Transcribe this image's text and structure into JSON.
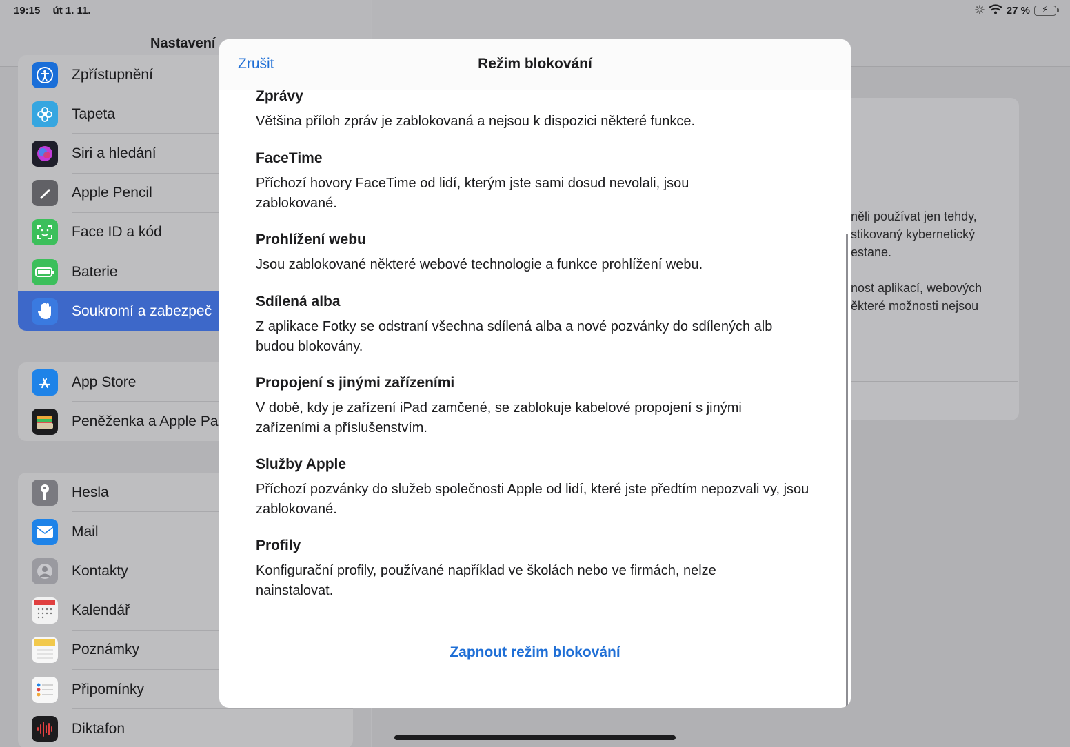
{
  "status": {
    "time": "19:15",
    "date": "út 1. 11.",
    "battery": "27 %",
    "battery_level": 0.27
  },
  "sidebar": {
    "title": "Nastavení",
    "group1": [
      {
        "label": "Zpřístupnění",
        "icon": "accessibility-icon",
        "color": "#1a6ed8"
      },
      {
        "label": "Tapeta",
        "icon": "flower-icon",
        "color": "#36a6e0"
      },
      {
        "label": "Siri a hledání",
        "icon": "siri-icon",
        "color": "#2a2a3a"
      },
      {
        "label": "Apple Pencil",
        "icon": "pencil-icon",
        "color": "#616166"
      },
      {
        "label": "Face ID a kód",
        "icon": "face-id-icon",
        "color": "#3cbf5b"
      },
      {
        "label": "Baterie",
        "icon": "battery-icon",
        "color": "#3cbf5b"
      },
      {
        "label": "Soukromí a zabezpeč",
        "icon": "hand-icon",
        "color": "#3a7ae0"
      }
    ],
    "group2": [
      {
        "label": "App Store",
        "icon": "app-store-icon",
        "color": "#1e83e8"
      },
      {
        "label": "Peněženka a Apple Pa",
        "icon": "wallet-icon",
        "color": "#1c1c1e"
      }
    ],
    "group3": [
      {
        "label": "Hesla",
        "icon": "key-icon",
        "color": "#7a7a80"
      },
      {
        "label": "Mail",
        "icon": "mail-icon",
        "color": "#1e83e8"
      },
      {
        "label": "Kontakty",
        "icon": "contacts-icon",
        "color": "#9a9aa0"
      },
      {
        "label": "Kalendář",
        "icon": "calendar-icon",
        "color": "#f2f2f2"
      },
      {
        "label": "Poznámky",
        "icon": "notes-icon",
        "color": "#f2c94c"
      },
      {
        "label": "Připomínky",
        "icon": "reminders-icon",
        "color": "#f2f2f2"
      },
      {
        "label": "Diktafon",
        "icon": "voice-memo-icon",
        "color": "#1c1c1e"
      }
    ]
  },
  "detail": {
    "lines": [
      "něli používat jen tehdy,",
      "stikovaný kybernetický",
      "estane.",
      "nost aplikací, webových",
      "ěkteré možnosti nejsou"
    ]
  },
  "modal": {
    "cancel": "Zrušit",
    "title": "Režim blokování",
    "sections": [
      {
        "title": "Zprávy",
        "text": "Většina příloh zpráv je zablokovaná a nejsou k dispozici některé funkce."
      },
      {
        "title": "FaceTime",
        "text": "Příchozí hovory FaceTime od lidí, kterým jste sami dosud nevolali, jsou zablokované."
      },
      {
        "title": "Prohlížení webu",
        "text": "Jsou zablokované některé webové technologie a funkce prohlížení webu."
      },
      {
        "title": "Sdílená alba",
        "text": "Z aplikace Fotky se odstraní všechna sdílená alba a nové pozvánky do sdílených alb budou blokovány."
      },
      {
        "title": "Propojení s jinými zařízeními",
        "text": "V době, kdy je zařízení iPad zamčené, se zablokuje kabelové propojení s jinými zařízeními a příslušenstvím."
      },
      {
        "title": "Služby Apple",
        "text": "Příchozí pozvánky do služeb společnosti Apple od lidí, které jste předtím nepozvali vy, jsou zablokované."
      },
      {
        "title": "Profily",
        "text": "Konfigurační profily, používané například ve školách nebo ve firmách, nelze nainstalovat."
      }
    ],
    "action": "Zapnout režim blokování"
  },
  "colors": {
    "accent": "#1f6fd6",
    "selected": "#3d68c9"
  }
}
